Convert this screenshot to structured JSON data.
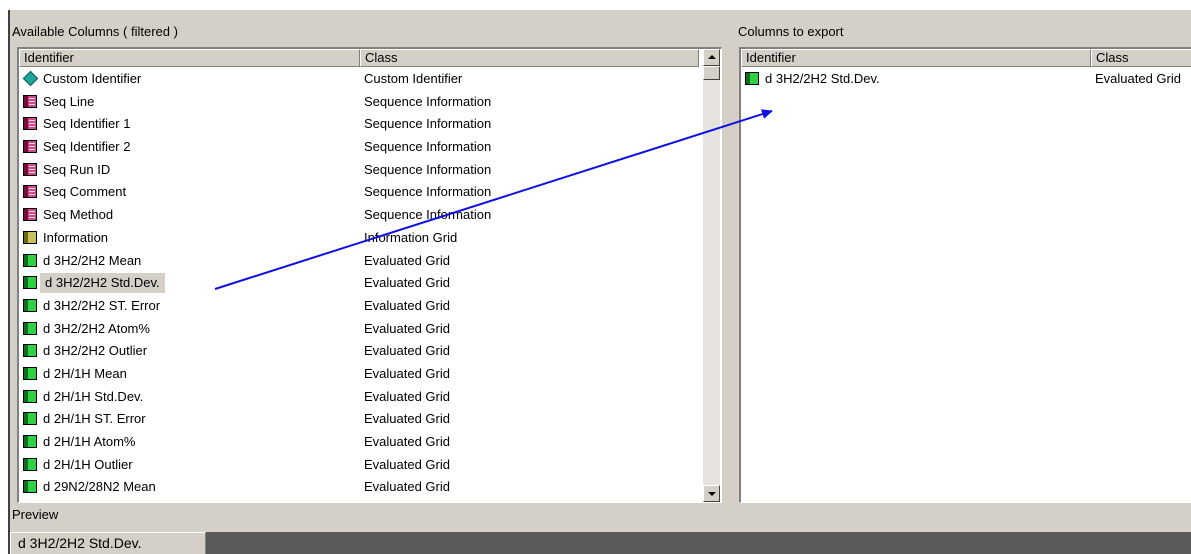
{
  "available": {
    "title": "Available Columns ( filtered )",
    "headers": {
      "identifier": "Identifier",
      "class": "Class"
    },
    "rows": [
      {
        "icon": "diamond-icon",
        "kind": "diamond",
        "identifier": "Custom Identifier",
        "class": "Custom Identifier"
      },
      {
        "icon": "sequence-grid-icon",
        "kind": "seq",
        "identifier": "Seq Line",
        "class": "Sequence Information"
      },
      {
        "icon": "sequence-grid-icon",
        "kind": "seq",
        "identifier": "Seq Identifier 1",
        "class": "Sequence Information"
      },
      {
        "icon": "sequence-grid-icon",
        "kind": "seq",
        "identifier": "Seq Identifier 2",
        "class": "Sequence Information"
      },
      {
        "icon": "sequence-grid-icon",
        "kind": "seq",
        "identifier": "Seq Run ID",
        "class": "Sequence Information"
      },
      {
        "icon": "sequence-grid-icon",
        "kind": "seq",
        "identifier": "Seq Comment",
        "class": "Sequence Information"
      },
      {
        "icon": "sequence-grid-icon",
        "kind": "seq",
        "identifier": "Seq Method",
        "class": "Sequence Information"
      },
      {
        "icon": "information-grid-icon",
        "kind": "info",
        "identifier": "Information",
        "class": "Information Grid"
      },
      {
        "icon": "evaluated-grid-icon",
        "kind": "eval",
        "identifier": "d  3H2/2H2  Mean",
        "class": "Evaluated Grid"
      },
      {
        "icon": "evaluated-grid-icon",
        "kind": "eval",
        "identifier": "d  3H2/2H2  Std.Dev.",
        "class": "Evaluated Grid",
        "selected": true
      },
      {
        "icon": "evaluated-grid-icon",
        "kind": "eval",
        "identifier": "d  3H2/2H2  ST. Error",
        "class": "Evaluated Grid"
      },
      {
        "icon": "evaluated-grid-icon",
        "kind": "eval",
        "identifier": "d  3H2/2H2 Atom%",
        "class": "Evaluated Grid"
      },
      {
        "icon": "evaluated-grid-icon",
        "kind": "eval",
        "identifier": "d  3H2/2H2 Outlier",
        "class": "Evaluated Grid"
      },
      {
        "icon": "evaluated-grid-icon",
        "kind": "eval",
        "identifier": "d  2H/1H  Mean",
        "class": "Evaluated Grid"
      },
      {
        "icon": "evaluated-grid-icon",
        "kind": "eval",
        "identifier": "d  2H/1H  Std.Dev.",
        "class": "Evaluated Grid"
      },
      {
        "icon": "evaluated-grid-icon",
        "kind": "eval",
        "identifier": "d  2H/1H  ST. Error",
        "class": "Evaluated Grid"
      },
      {
        "icon": "evaluated-grid-icon",
        "kind": "eval",
        "identifier": "d  2H/1H Atom%",
        "class": "Evaluated Grid"
      },
      {
        "icon": "evaluated-grid-icon",
        "kind": "eval",
        "identifier": "d  2H/1H Outlier",
        "class": "Evaluated Grid"
      },
      {
        "icon": "evaluated-grid-icon",
        "kind": "eval",
        "identifier": "d  29N2/28N2  Mean",
        "class": "Evaluated Grid"
      }
    ]
  },
  "export": {
    "title": "Columns to export",
    "headers": {
      "identifier": "Identifier",
      "class": "Class"
    },
    "rows": [
      {
        "icon": "evaluated-grid-icon",
        "kind": "eval",
        "identifier": "d  3H2/2H2  Std.Dev.",
        "class": "Evaluated Grid"
      }
    ]
  },
  "preview": {
    "label": "Preview",
    "value": "d  3H2/2H2  Std.Dev."
  },
  "colors": {
    "arrow": "#1010e0",
    "window": "#d4d0c8",
    "preview_strip": "#5a5a5a"
  }
}
